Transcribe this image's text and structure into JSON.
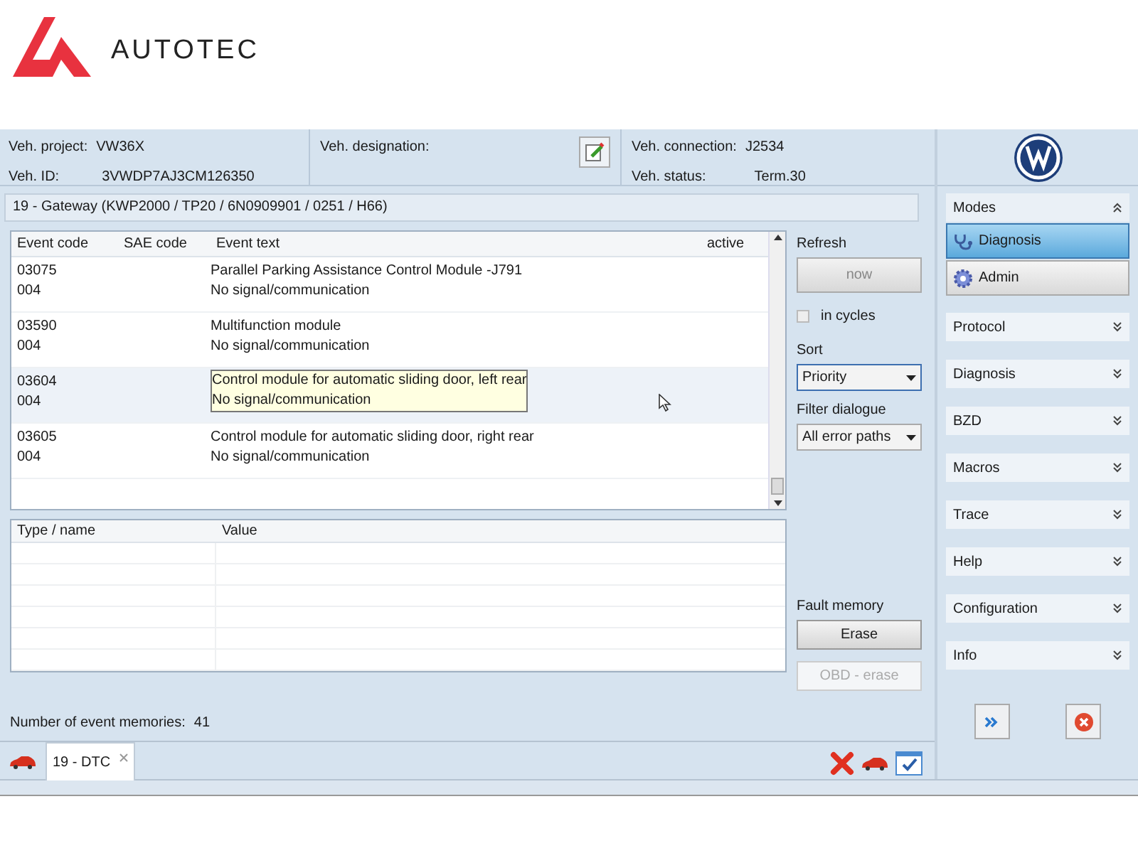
{
  "brand": {
    "name": "AUTOTEC"
  },
  "vehicle": {
    "project_label": "Veh. project:",
    "project": "VW36X",
    "id_label": "Veh. ID:",
    "id": "3VWDP7AJ3CM126350",
    "designation_label": "Veh. designation:",
    "connection_label": "Veh. connection:",
    "connection": "J2534",
    "status_label": "Veh. status:",
    "status": "Term.30"
  },
  "ecu": {
    "title": "19 - Gateway  (KWP2000 / TP20 / 6N0909901   / 0251 / H66)"
  },
  "table": {
    "columns": [
      "Event code",
      "SAE code",
      "Event text",
      "active"
    ],
    "rows": [
      {
        "codes": [
          "03075",
          "004"
        ],
        "lines": [
          "Parallel Parking Assistance Control Module -J791",
          "No signal/communication"
        ],
        "selected": false,
        "tooltip": false
      },
      {
        "codes": [
          "03590",
          "004"
        ],
        "lines": [
          "Multifunction module",
          "No signal/communication"
        ],
        "selected": false,
        "tooltip": false
      },
      {
        "codes": [
          "03604",
          "004"
        ],
        "lines": [
          "Control module for automatic sliding door, left rear",
          "No signal/communication"
        ],
        "selected": true,
        "tooltip": true
      },
      {
        "codes": [
          "03605",
          "004"
        ],
        "lines": [
          "Control module for automatic sliding door, right rear",
          "No signal/communication"
        ],
        "selected": false,
        "tooltip": false
      }
    ]
  },
  "details": {
    "columns": [
      "Type / name",
      "Value"
    ]
  },
  "controls": {
    "refresh_label": "Refresh",
    "now_button": "now",
    "cycles": {
      "label": "in cycles",
      "checked": false
    },
    "sort_label": "Sort",
    "sort_value": "Priority",
    "filter_label": "Filter dialogue",
    "filter_value": "All error paths",
    "fault_label": "Fault memory",
    "erase_button": "Erase",
    "obd_button": {
      "label": "OBD - erase",
      "disabled": true
    }
  },
  "count": {
    "label": "Number of event memories:",
    "value": "41"
  },
  "tabs": [
    {
      "label": "19 - DTC",
      "selected": true
    }
  ],
  "sidebar": {
    "modes_title": "Modes",
    "modes": [
      {
        "label": "Diagnosis",
        "selected": true,
        "kind": "stethoscope"
      },
      {
        "label": "Admin",
        "selected": false,
        "kind": "gear"
      }
    ],
    "sections": [
      {
        "label": "Protocol"
      },
      {
        "label": "Diagnosis"
      },
      {
        "label": "BZD"
      },
      {
        "label": "Macros"
      },
      {
        "label": "Trace"
      },
      {
        "label": "Help"
      },
      {
        "label": "Configuration"
      },
      {
        "label": "Info"
      }
    ]
  }
}
